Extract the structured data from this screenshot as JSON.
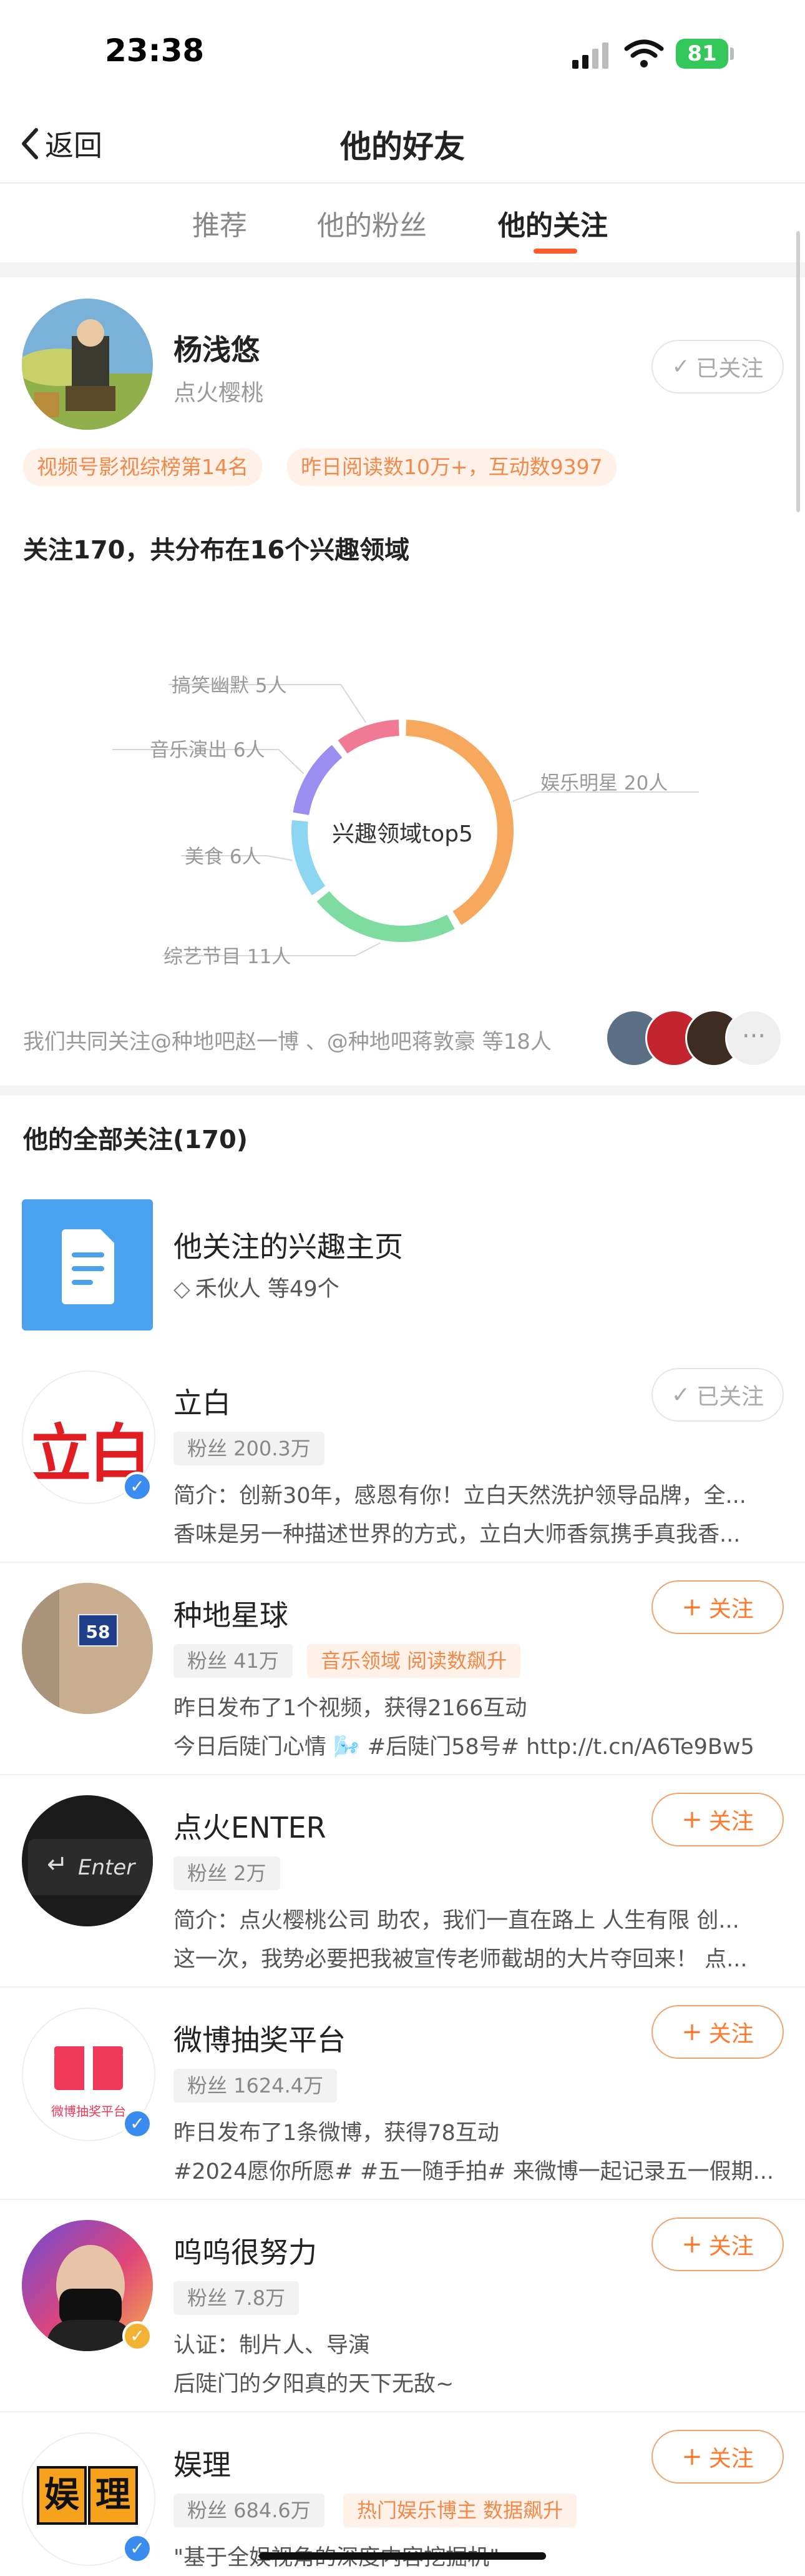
{
  "status_bar": {
    "time": "23:38",
    "battery": "81"
  },
  "nav": {
    "back_label": "返回",
    "title": "他的好友"
  },
  "tabs": [
    {
      "label": "推荐",
      "active": false
    },
    {
      "label": "他的粉丝",
      "active": false
    },
    {
      "label": "他的关注",
      "active": true
    }
  ],
  "profile": {
    "name": "杨浅悠",
    "subtitle": "点火樱桃",
    "follow_label": "已关注",
    "tags": [
      "视频号影视综榜第14名",
      "昨日阅读数10万+，互动数9397"
    ]
  },
  "interest": {
    "title": "关注170，共分布在16个兴趣领域",
    "center_label": "兴趣领域top5"
  },
  "chart_data": {
    "type": "pie",
    "categories": [
      "娱乐明星",
      "综艺节目",
      "美食",
      "音乐演出",
      "搞笑幽默"
    ],
    "values": [
      20,
      11,
      6,
      6,
      5
    ],
    "labels": [
      "娱乐明星 20人",
      "综艺节目 11人",
      "美食 6人",
      "音乐演出 6人",
      "搞笑幽默 5人"
    ],
    "colors": [
      "#f6a95c",
      "#7fdca0",
      "#8dd6f2",
      "#9b8ef0",
      "#f07a93"
    ]
  },
  "common_follow": {
    "text": "我们共同关注@种地吧赵一博 、@种地吧蒋敦豪 等18人",
    "more_icon": "more-dots-icon"
  },
  "all_follow": {
    "title": "他的全部关注(170)",
    "interest_page": {
      "title": "他关注的兴趣主页",
      "subtitle": "禾伙人 等49个"
    }
  },
  "items": [
    {
      "name": "立白",
      "fans": "粉丝 200.3万",
      "hot": "",
      "follow_label": "已关注",
      "following": true,
      "verified_color": "#3b8cf0",
      "line1": "简介：创新30年，感恩有你！立白天然洗护领导品牌，全...",
      "line2": "香味是另一种描述世界的方式，立白大师香氛携手真我香..."
    },
    {
      "name": "种地星球",
      "fans": "粉丝 41万",
      "hot": "音乐领域 阅读数飙升",
      "follow_label": "关注",
      "following": false,
      "verified_color": "",
      "line1": "昨日发布了1个视频，获得2166互动",
      "line2": "今日后陡门心情 🌬️ #后陡门58号# http://t.cn/A6Te9Bw5"
    },
    {
      "name": "点火ENTER",
      "fans": "粉丝 2万",
      "hot": "",
      "follow_label": "关注",
      "following": false,
      "verified_color": "",
      "line1": "简介：点火樱桃公司 助农，我们一直在路上 人生有限 创...",
      "line2": "这一次，我势必要把我被宣传老师截胡的大片夺回来！ 点..."
    },
    {
      "name": "微博抽奖平台",
      "fans": "粉丝 1624.4万",
      "hot": "",
      "follow_label": "关注",
      "following": false,
      "verified_color": "#3b8cf0",
      "line1": "昨日发布了1条微博，获得78互动",
      "line2": "#2024愿你所愿# #五一随手拍# 来微博一起记录五一假期..."
    },
    {
      "name": "呜呜很努力",
      "fans": "粉丝 7.8万",
      "hot": "",
      "follow_label": "关注",
      "following": false,
      "verified_color": "#f2b233",
      "line1": "认证：制片人、导演",
      "line2": "后陡门的夕阳真的天下无敌~"
    },
    {
      "name": "娱理",
      "fans": "粉丝 684.6万",
      "hot": "热门娱乐博主 数据飙升",
      "follow_label": "关注",
      "following": false,
      "verified_color": "#3b8cf0",
      "line1": "\"基于全娱视角的深度内容挖掘机\"",
      "line2": ""
    }
  ],
  "avatars": {
    "libai_logo_text": "立白",
    "house_number": "58",
    "enter_key_text": "Enter",
    "lottery_text": "微博抽奖平台",
    "yuli_chars": [
      "娱",
      "理"
    ]
  }
}
